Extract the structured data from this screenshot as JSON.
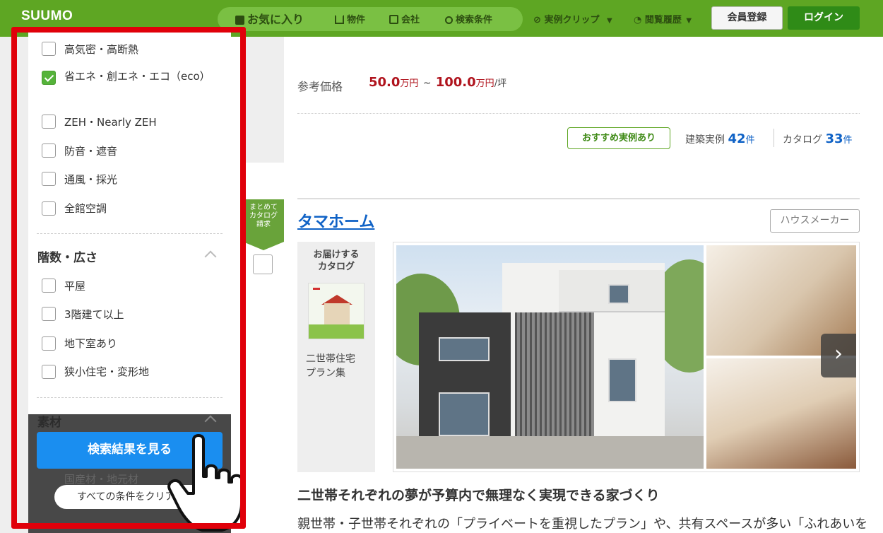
{
  "header": {
    "logo": "SUUMO",
    "nav": {
      "favorites": "お気に入り",
      "property": "物件",
      "company": "会社",
      "search_conditions": "検索条件",
      "clip": "実例クリップ",
      "history": "閲覧履歴"
    },
    "register_label": "会員登録",
    "login_label": "ログイン"
  },
  "main": {
    "price_label": "参考価格",
    "price_min": "50.0",
    "price_max": "100.0",
    "price_unit": "万円",
    "price_sep": "~",
    "price_per": "/坪",
    "reco_badge": "おすすめ実例あり",
    "jirei_label": "建築実例",
    "jirei_count": "42",
    "catalog_label": "カタログ",
    "catalog_count": "33",
    "count_unit": "件",
    "side_tab": "まとめて\nカタログ\n請求",
    "company_name": "タマホーム",
    "maker_badge": "ハウスメーカー",
    "catalog_box_title": "お届けする\nカタログ",
    "catalog_name": "二世帯住宅\nプラン集",
    "desc_title": "二世帯それぞれの夢が予算内で無理なく実現できる家づくり",
    "desc_body": "親世帯・子世帯それぞれの「プライベートを重視したプラン」や、共有スペースが多い「ふれあいを"
  },
  "filter_panel": {
    "options_top": [
      {
        "label": "高気密・高断熱",
        "checked": false
      },
      {
        "label": "省エネ・創エネ・エコ（eco）",
        "checked": true
      },
      {
        "label": "ZEH・Nearly ZEH",
        "checked": false
      },
      {
        "label": "防音・遮音",
        "checked": false
      },
      {
        "label": "通風・採光",
        "checked": false
      },
      {
        "label": "全館空調",
        "checked": false
      }
    ],
    "section_floors": "階数・広さ",
    "options_floors": [
      {
        "label": "平屋",
        "checked": false
      },
      {
        "label": "3階建て以上",
        "checked": false
      },
      {
        "label": "地下室あり",
        "checked": false
      },
      {
        "label": "狭小住宅・変形地",
        "checked": false
      }
    ],
    "section_material": "素材",
    "ghost_option": "国産材・地元材",
    "search_button": "検索結果を見る",
    "clear_button": "すべての条件をクリア"
  },
  "colors": {
    "header_green": "#5ea623",
    "highlight_red": "#e0000a",
    "search_blue": "#1a8ef0",
    "price_red": "#b0141e",
    "link_blue": "#0f62c6"
  }
}
